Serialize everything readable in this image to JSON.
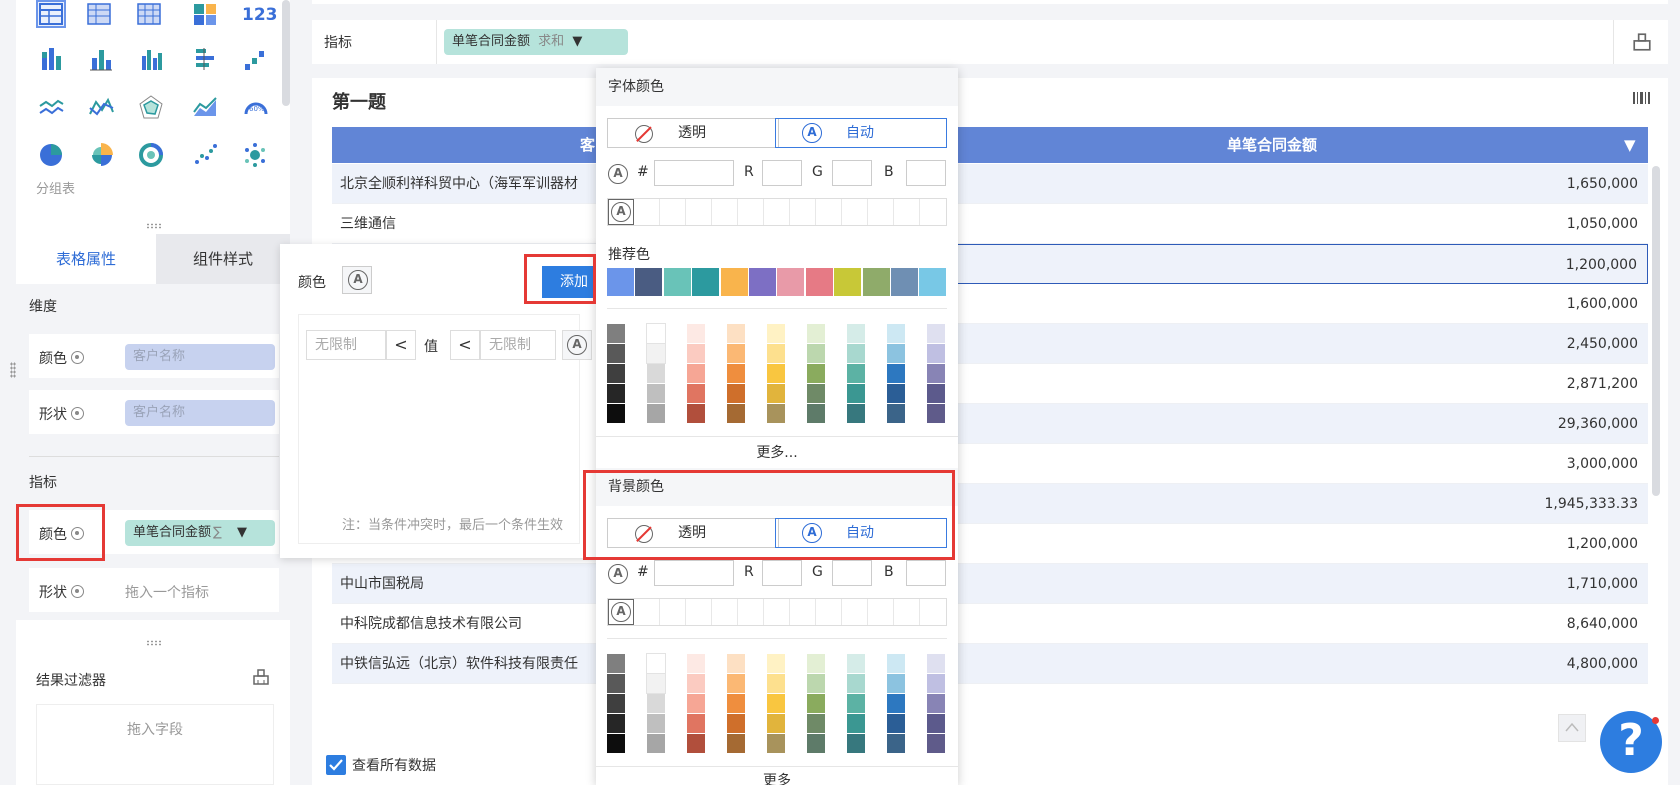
{
  "left_panel": {
    "group_label": "分组表",
    "tabs": [
      {
        "label": "表格属性"
      },
      {
        "label": "组件样式"
      }
    ],
    "dimension_section": "维度",
    "dim_color_label": "颜色",
    "dim_color_field": "客户名称",
    "dim_shape_label": "形状",
    "dim_shape_field": "客户名称",
    "metric_section": "指标",
    "met_color_label": "颜色",
    "met_color_field": "单笔合同金额",
    "met_color_suffix": "∑",
    "met_shape_label": "形状",
    "met_shape_placeholder": "拖入一个指标",
    "result_filter": "结果过滤器",
    "drag_field": "拖入字段",
    "number_icon_text": "123"
  },
  "metric_bar": {
    "label": "指标",
    "field": "单笔合同金额",
    "agg": "求和"
  },
  "table_card": {
    "title": "第一题",
    "col1_header": "客",
    "col2_header": "单笔合同金额",
    "rows": [
      {
        "name": "北京全顺利祥科贸中心（海军军训器材",
        "amount": "1,650,000"
      },
      {
        "name": "三维通信",
        "amount": "1,050,000"
      },
      {
        "name": "",
        "amount": "1,200,000"
      },
      {
        "name": "",
        "amount": "1,600,000"
      },
      {
        "name": "",
        "amount": "2,450,000"
      },
      {
        "name": "",
        "amount": "2,871,200"
      },
      {
        "name": "",
        "amount": "29,360,000"
      },
      {
        "name": "",
        "amount": "3,000,000"
      },
      {
        "name": "",
        "amount": "1,945,333.33"
      },
      {
        "name": "",
        "amount": "1,200,000"
      },
      {
        "name": "中山市国税局",
        "amount": "1,710,000"
      },
      {
        "name": "中科院成都信息技术有限公司",
        "amount": "8,640,000"
      },
      {
        "name": "中铁信弘远（北京）软件科技有限责任",
        "amount": "4,800,000"
      }
    ],
    "view_all_label": "查看所有数据"
  },
  "cond_panel": {
    "color_label": "颜色",
    "add_button": "添加",
    "min_placeholder": "无限制",
    "op1": "<",
    "value_label": "值",
    "op2": "<",
    "max_placeholder": "无限制",
    "note": "注：当条件冲突时，最后一个条件生效"
  },
  "color_popup": {
    "font_color_title": "字体颜色",
    "bg_color_title": "背景颜色",
    "transparent_label": "透明",
    "auto_label": "自动",
    "hex_label": "#",
    "r_label": "R",
    "g_label": "G",
    "b_label": "B",
    "recommended_title": "推荐色",
    "more_label": "更多...",
    "more_label_2": "更多",
    "recommended_colors": [
      "#6b95ea",
      "#4a5c82",
      "#69c3b8",
      "#2c9a9f",
      "#f9b44c",
      "#7d6fc4",
      "#e89aa8",
      "#e67a85",
      "#c8c837",
      "#8fab6a",
      "#6f8fb3",
      "#78c8e6"
    ],
    "palette_columns": [
      [
        "#7f7f7f",
        "#595959",
        "#3f3f3f",
        "#262626",
        "#0d0d0d"
      ],
      [
        "#ffffff",
        "#f2f2f2",
        "#d9d9d9",
        "#bfbfbf",
        "#a6a6a6"
      ],
      [
        "#fde9e4",
        "#fbcbc1",
        "#f6a695",
        "#e07561",
        "#b14f3c"
      ],
      [
        "#fde0c3",
        "#fbb874",
        "#ef8e3e",
        "#cf6f2b",
        "#a56a33"
      ],
      [
        "#fff2c4",
        "#fde08e",
        "#f9c640",
        "#e1b43c",
        "#a8935c"
      ],
      [
        "#e3efd4",
        "#bcd7ae",
        "#8aab5e",
        "#6f8a67",
        "#5e7b69"
      ],
      [
        "#d5ece8",
        "#a8d8cf",
        "#5cb2a4",
        "#3b9792",
        "#37787e"
      ],
      [
        "#cde8f3",
        "#8cc3e0",
        "#2d78c0",
        "#2b5e96",
        "#3b6489"
      ],
      [
        "#dfe0f0",
        "#bfbfe2",
        "#8884b5",
        "#5c5a8c",
        "#5f5b8a"
      ]
    ]
  },
  "help_label": "?"
}
